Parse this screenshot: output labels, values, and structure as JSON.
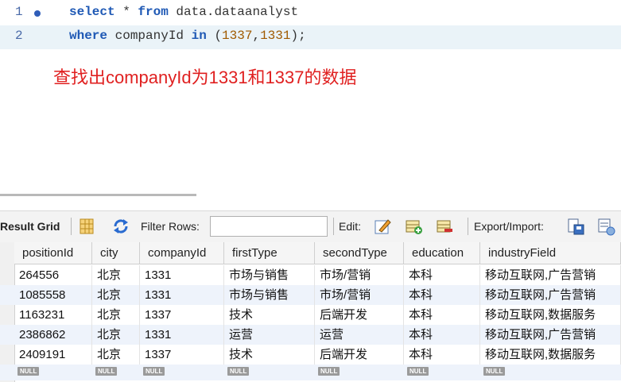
{
  "editor": {
    "line_numbers": [
      "1",
      "2"
    ],
    "line1": {
      "kw1": "select",
      "rest1": " * ",
      "kw2": "from",
      "rest2": " data.dataanalyst"
    },
    "line2": {
      "kw1": "where",
      "rest1": " companyId ",
      "kw2": "in",
      "p1": " (",
      "n1": "1337",
      "comma": ",",
      "n2": "1331",
      "p2": ");"
    }
  },
  "annotation": "查找出companyId为1331和1337的数据",
  "toolbar": {
    "result_grid": "Result Grid",
    "filter_rows": "Filter Rows:",
    "filter_value": "",
    "edit": "Edit:",
    "export_import": "Export/Import:"
  },
  "grid": {
    "columns": [
      "positionId",
      "city",
      "companyId",
      "firstType",
      "secondType",
      "education",
      "industryField"
    ],
    "rows": [
      [
        "264556",
        "北京",
        "1331",
        "市场与销售",
        "市场/营销",
        "本科",
        "移动互联网,广告营销"
      ],
      [
        "1085558",
        "北京",
        "1331",
        "市场与销售",
        "市场/营销",
        "本科",
        "移动互联网,广告营销"
      ],
      [
        "1163231",
        "北京",
        "1337",
        "技术",
        "后端开发",
        "本科",
        "移动互联网,数据服务"
      ],
      [
        "2386862",
        "北京",
        "1331",
        "运营",
        "运营",
        "本科",
        "移动互联网,广告营销"
      ],
      [
        "2409191",
        "北京",
        "1337",
        "技术",
        "后端开发",
        "本科",
        "移动互联网,数据服务"
      ]
    ],
    "null_label": "NULL"
  },
  "colors": {
    "keyword": "#1f59b5",
    "number": "#a05a00",
    "annotation": "#e02020",
    "row_alt": "#eef3fb"
  }
}
